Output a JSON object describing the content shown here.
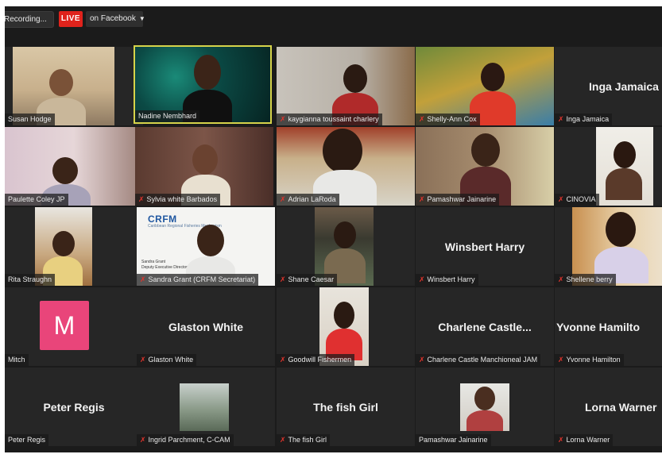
{
  "topbar": {
    "recording_label": "Recording...",
    "live_label": "LIVE",
    "platform_label": "on Facebook",
    "caret_icon": "chevron-down-icon"
  },
  "participants": [
    {
      "name": "Susan Hodge",
      "muted": false,
      "video": true
    },
    {
      "name": "Nadine Nembhard",
      "muted": false,
      "video": true,
      "active_speaker": true
    },
    {
      "name": "kaygianna toussaint charlery",
      "muted": true,
      "video": true
    },
    {
      "name": "Shelly-Ann Cox",
      "muted": true,
      "video": true
    },
    {
      "name": "Inga Jamaica",
      "muted": true,
      "video": false,
      "display_name": "Inga Jamaica"
    },
    {
      "name": "Paulette Coley JP",
      "muted": false,
      "video": true
    },
    {
      "name": "Sylvia white Barbados",
      "muted": true,
      "video": true
    },
    {
      "name": "Adrian LaRoda",
      "muted": true,
      "video": true
    },
    {
      "name": "Pamashwar Jainarine",
      "muted": true,
      "video": true
    },
    {
      "name": "CINOVIA",
      "muted": true,
      "video": true
    },
    {
      "name": "Rita Straughn",
      "muted": false,
      "video": true
    },
    {
      "name": "Sandra Grant (CRFM Secretariat)",
      "muted": true,
      "video": true
    },
    {
      "name": "Shane Caesar",
      "muted": true,
      "video": true
    },
    {
      "name": "Winsbert Harry",
      "muted": true,
      "video": false,
      "display_name": "Winsbert Harry"
    },
    {
      "name": "Shellene berry",
      "muted": true,
      "video": true
    },
    {
      "name": "Mitch",
      "muted": false,
      "video": false,
      "avatar_letter": "M"
    },
    {
      "name": "Glaston White",
      "muted": true,
      "video": false,
      "display_name": "Glaston White"
    },
    {
      "name": "Goodwill Fishermen",
      "muted": true,
      "video": true
    },
    {
      "name": "Charlene Castle Manchioneal JAM",
      "muted": true,
      "video": false,
      "display_name": "Charlene  Castle..."
    },
    {
      "name": "Yvonne Hamilton",
      "muted": true,
      "video": false,
      "display_name": "Yvonne Hamilto"
    },
    {
      "name": "Peter Regis",
      "muted": false,
      "video": false,
      "display_name": "Peter Regis"
    },
    {
      "name": "Ingrid Parchment, C-CAM",
      "muted": true,
      "video": true
    },
    {
      "name": "The fish Girl",
      "muted": true,
      "video": false,
      "display_name": "The fish Girl"
    },
    {
      "name": "Pamashwar Jainarine",
      "muted": false,
      "video": true
    },
    {
      "name": "Lorna Warner",
      "muted": true,
      "video": false,
      "display_name": "Lorna Warner"
    }
  ],
  "slide": {
    "logo_text": "CRFM",
    "org_text": "Caribbean Regional Fisheries Mechanism",
    "person_line": "Sandra Grant",
    "role_line": "Deputy Executive Director"
  },
  "colors": {
    "background": "#1b1b1b",
    "tile": "#262626",
    "live_red": "#e0231c",
    "active_border": "#d6d34a",
    "mute_red": "#e0342c",
    "avatar_pink": "#e9457a"
  },
  "icons": {
    "mute": "muted-microphone-icon"
  }
}
